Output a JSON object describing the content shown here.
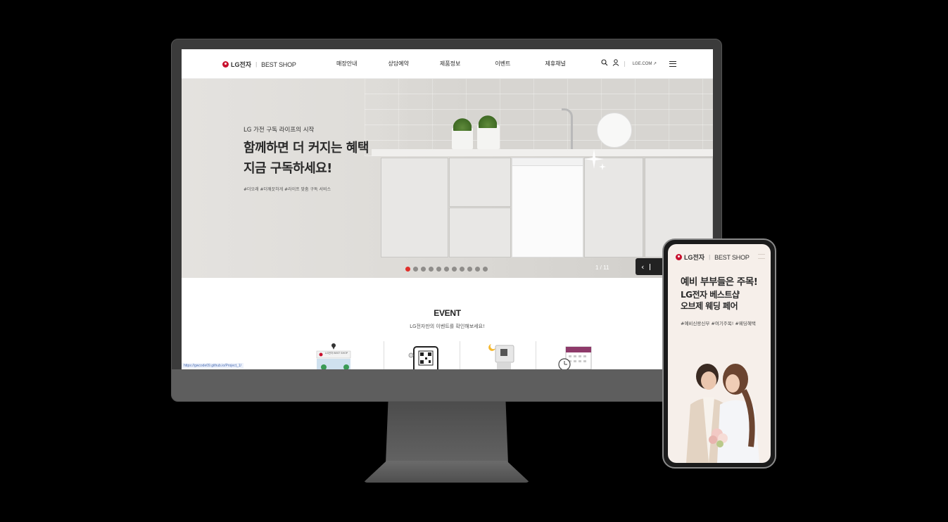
{
  "desktop": {
    "logo": {
      "brand": "LG전자",
      "separator": "|",
      "shop": "BEST SHOP"
    },
    "nav": [
      "매장안내",
      "상담예약",
      "제품정보",
      "이벤트",
      "제휴채널"
    ],
    "tools": {
      "separator": "|",
      "lge_link": "LGE.COM ↗"
    },
    "hero": {
      "subtitle": "LG 가전 구독 라이프의 시작",
      "title_line1": "함께하면 더 커지는 혜택",
      "title_line2": "지금 구독하세요!",
      "tags": "#더오래 #더깨끗하게 #라이프 맞춤 구독 서비스",
      "slide_count": 11,
      "active_slide": 1,
      "page_indicator": "1 / 11",
      "prev_icon": "‹"
    },
    "event": {
      "title": "EVENT",
      "subtitle": "LG전자만의 이벤트를 확인해보세요!",
      "store_sign": "LG전자 BEST SHOP"
    },
    "status_url": "https://gwcode09.github.io/Project_1/"
  },
  "mobile": {
    "logo": {
      "brand": "LG전자",
      "separator": "|",
      "shop": "BEST SHOP"
    },
    "title_line1": "예비 부부들은 주목!",
    "title_line2": "LG전자 베스트샵",
    "title_line3": "오브제 웨딩 페어",
    "tags": "#예비신랑신부 #여기주목! #웨딩혜택"
  },
  "colors": {
    "accent": "#e0312c",
    "lg_red": "#c8102e",
    "device_frame": "#3b3b3b"
  }
}
